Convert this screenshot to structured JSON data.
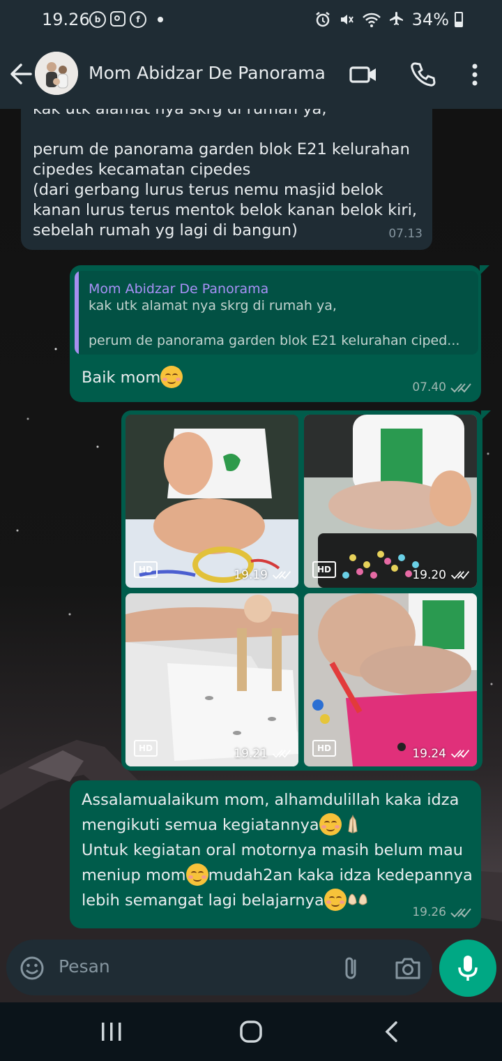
{
  "status_bar": {
    "time": "19.26",
    "left_icons": [
      "b-icon",
      "instagram-icon",
      "facebook-icon",
      "dot-icon"
    ],
    "battery": "34%"
  },
  "header": {
    "contact_name": "Mom Abidzar De Panorama"
  },
  "messages": {
    "m1": {
      "lines": "kak utk alamat nya skrg di rumah ya,\n\nperum de panorama garden blok E21 kelurahan\ncipedes kecamatan cipedes\n(dari gerbang lurus terus nemu masjid belok\nkanan lurus terus mentok belok kanan belok kiri,\nsebelah rumah yg lagi di bangun)",
      "time": "07.13"
    },
    "m2": {
      "quote_name": "Mom Abidzar De Panorama",
      "quote_text": "kak utk alamat nya skrg di rumah ya,\n\nperum de panorama garden blok E21 kelurahan ciped...",
      "text": "Baik mom",
      "time": "07.40"
    },
    "media": [
      {
        "badge": "HD",
        "time": "19.19"
      },
      {
        "badge": "HD",
        "time": "19.20"
      },
      {
        "badge": "HD",
        "time": "19.21"
      },
      {
        "badge": "HD",
        "time": "19.24"
      }
    ],
    "m3": {
      "line1": "Assalamualaikum mom, alhamdulillah kaka idza",
      "line2": "mengikuti semua kegiatannya",
      "line3": "Untuk kegiatan oral motornya masih belum mau",
      "line4a": "meniup mom",
      "line4b": "mudah2an kaka idza kedepannya",
      "line5": "lebih semangat lagi belajarnya",
      "time": "19.26"
    }
  },
  "input": {
    "placeholder": "Pesan"
  }
}
